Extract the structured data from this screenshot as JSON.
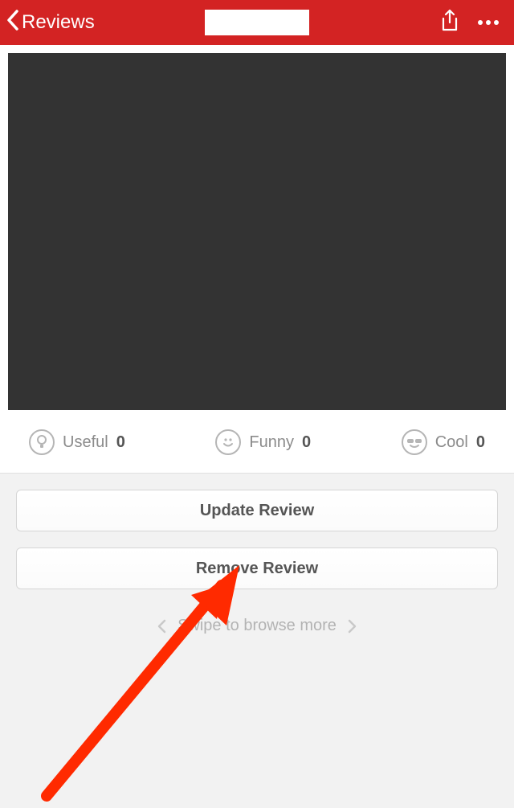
{
  "header": {
    "back_label": "Reviews"
  },
  "reactions": {
    "useful": {
      "label": "Useful",
      "count": "0"
    },
    "funny": {
      "label": "Funny",
      "count": "0"
    },
    "cool": {
      "label": "Cool",
      "count": "0"
    }
  },
  "buttons": {
    "update": "Update Review",
    "remove": "Remove Review"
  },
  "swipe_hint": "Swipe to browse more"
}
